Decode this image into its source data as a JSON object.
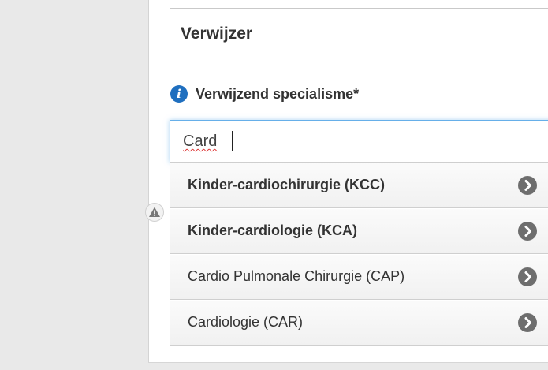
{
  "section": {
    "title": "Verwijzer"
  },
  "field": {
    "label": "Verwijzend specialisme*",
    "info_icon": "info-icon",
    "input_value": "Card"
  },
  "suggestions": [
    {
      "label": "Kinder-cardiochirurgie (KCC)"
    },
    {
      "label": "Kinder-cardiologie (KCA)"
    },
    {
      "label": "Cardio Pulmonale Chirurgie (CAP)"
    },
    {
      "label": "Cardiologie (CAR)"
    }
  ],
  "icons": {
    "chevron": "chevron-right-icon",
    "warning": "warning-icon"
  },
  "colors": {
    "accent": "#1f6fbf",
    "focus": "#66afe9",
    "chevron": "#6e6e6e"
  }
}
